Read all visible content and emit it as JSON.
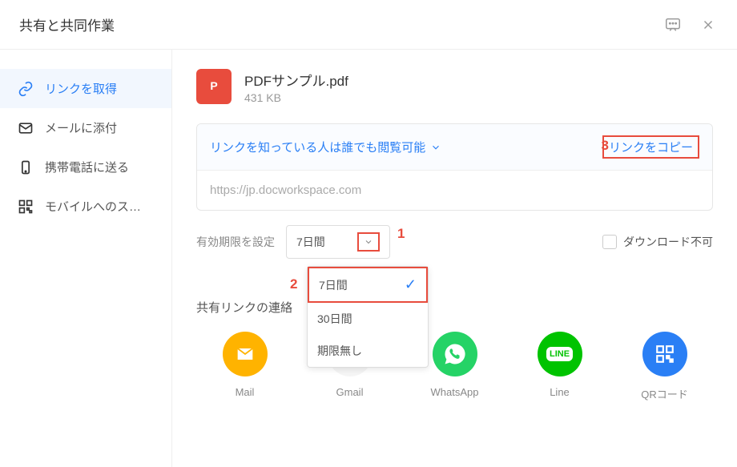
{
  "header": {
    "title": "共有と共同作業"
  },
  "sidebar": {
    "items": [
      {
        "label": "リンクを取得"
      },
      {
        "label": "メールに添付"
      },
      {
        "label": "携帯電話に送る"
      },
      {
        "label": "モバイルへのス…"
      }
    ]
  },
  "file": {
    "name": "PDFサンプル.pdf",
    "size": "431 KB"
  },
  "link": {
    "permission": "リンクを知っている人は誰でも閲覧可能",
    "copy": "リンクをコピー",
    "url": "https://jp.docworkspace.com"
  },
  "expiry": {
    "label": "有効期限を設定",
    "selected": "7日間",
    "options": [
      "7日間",
      "30日間",
      "期限無し"
    ]
  },
  "download": {
    "label": "ダウンロード不可"
  },
  "share": {
    "title": "共有リンクの連絡",
    "items": [
      {
        "name": "Mail"
      },
      {
        "name": "Gmail"
      },
      {
        "name": "WhatsApp"
      },
      {
        "name": "Line"
      },
      {
        "name": "QRコード"
      }
    ]
  },
  "annotations": {
    "a1": "1",
    "a2": "2",
    "a3": "3"
  }
}
